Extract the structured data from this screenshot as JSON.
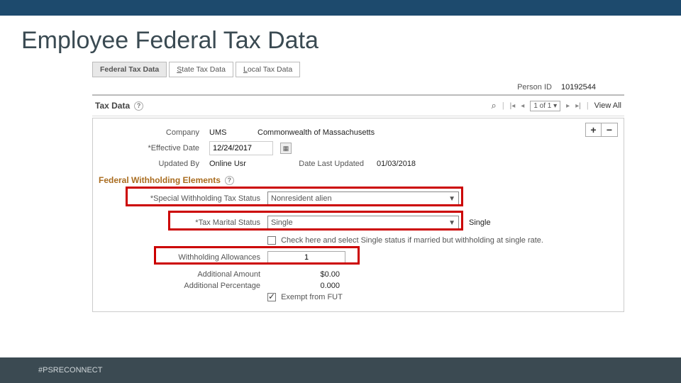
{
  "slide": {
    "title": "Employee Federal Tax Data"
  },
  "tabs": {
    "federal": "Federal Tax Data",
    "state_pre": "S",
    "state_rest": "tate Tax Data",
    "local_pre": "L",
    "local_rest": "ocal Tax Data"
  },
  "person": {
    "label": "Person ID",
    "value": "10192544"
  },
  "section": {
    "title": "Tax Data"
  },
  "pager": {
    "range": "1 of 1 ▾",
    "viewall": "View All"
  },
  "form": {
    "company_label": "Company",
    "company_value": "UMS",
    "company_desc": "Commonwealth of Massachusetts",
    "effdt_label": "Effective Date",
    "effdt_value": "12/24/2017",
    "updated_by_label": "Updated By",
    "updated_by_value": "Online Usr",
    "date_last_label": "Date Last Updated",
    "date_last_value": "01/03/2018"
  },
  "subsection": {
    "title": "Federal Withholding Elements"
  },
  "fields": {
    "swts_label": "Special Withholding Tax Status",
    "swts_value": "Nonresident alien",
    "marital_label": "Tax Marital Status",
    "marital_value": "Single",
    "marital_side": "Single",
    "check_note": "Check here and select Single status if married but withholding at single rate.",
    "allow_label": "Withholding Allowances",
    "allow_value": "1",
    "addl_amt_label": "Additional Amount",
    "addl_amt_value": "$0.00",
    "addl_pct_label": "Additional Percentage",
    "addl_pct_value": "0.000",
    "exempt_label": "Exempt from FUT"
  },
  "footer": {
    "hashtag": "#PSRECONNECT"
  }
}
